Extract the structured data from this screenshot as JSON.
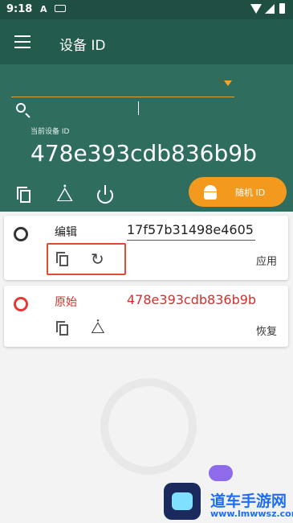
{
  "statusbar": {
    "time": "9:18",
    "notif": "A"
  },
  "appbar": {
    "title": "设备 ID"
  },
  "search": {
    "value": "",
    "placeholder": ""
  },
  "current": {
    "label": "当前设备 ID",
    "device_id": "478e393cdb836b9b"
  },
  "random_button": {
    "label": "随机 ID"
  },
  "cards": [
    {
      "label": "编辑",
      "id": "17f57b31498e4605",
      "action": "应用"
    },
    {
      "label": "原始",
      "id": "478e393cdb836b9b",
      "action": "恢复"
    }
  ],
  "brand": {
    "name": "道车手游网",
    "site": "www.lmwwsz.com"
  },
  "colors": {
    "header": "#235b4d",
    "panel": "#2f6e5e",
    "accent": "#f39a1e",
    "original": "#d32f2f"
  },
  "icons": [
    "menu-icon",
    "search-icon",
    "copy-icon",
    "share-icon",
    "power-icon",
    "android-icon",
    "refresh-icon"
  ]
}
